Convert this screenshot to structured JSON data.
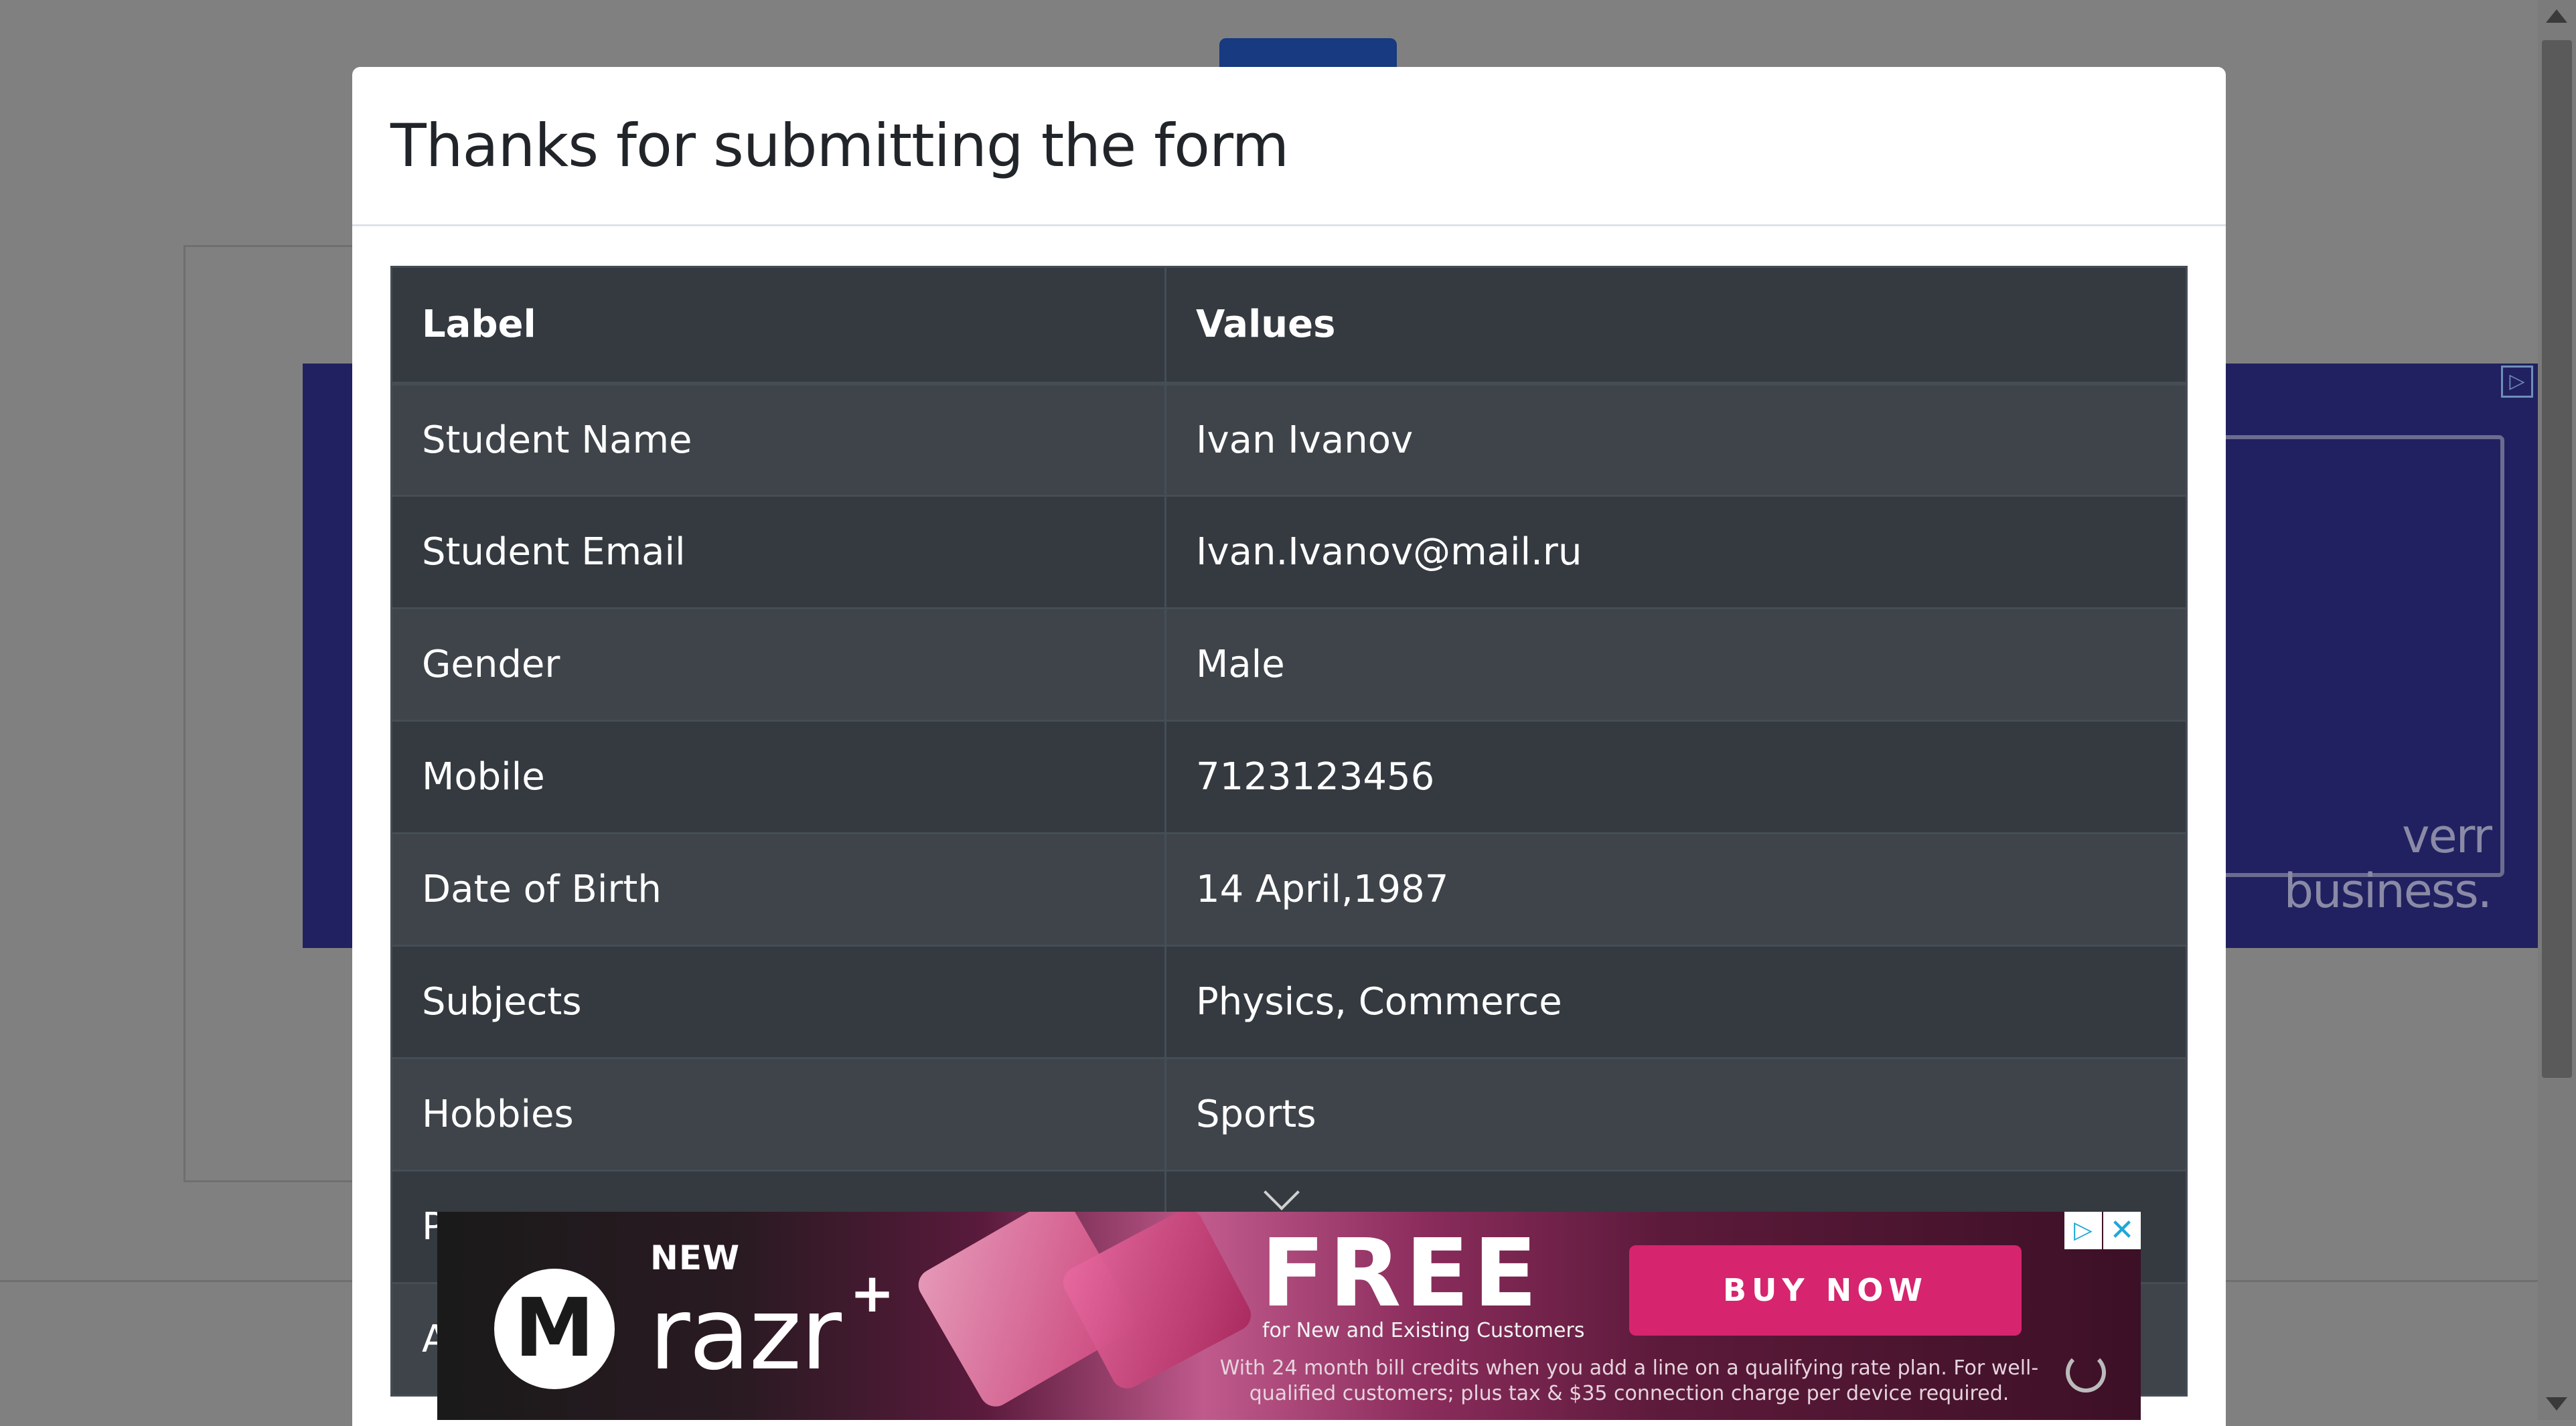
{
  "modal": {
    "title": "Thanks for submitting the form",
    "table": {
      "headers": [
        "Label",
        "Values"
      ],
      "rows": [
        {
          "label": "Student Name",
          "value": "Ivan Ivanov"
        },
        {
          "label": "Student Email",
          "value": "Ivan.Ivanov@mail.ru"
        },
        {
          "label": "Gender",
          "value": "Male"
        },
        {
          "label": "Mobile",
          "value": "7123123456"
        },
        {
          "label": "Date of Birth",
          "value": "14 April,1987"
        },
        {
          "label": "Subjects",
          "value": "Physics, Commerce"
        },
        {
          "label": "Hobbies",
          "value": "Sports"
        },
        {
          "label": "P",
          "value": ""
        },
        {
          "label": "A",
          "value": ""
        }
      ]
    }
  },
  "background_ad": {
    "brand_text": "verr business.",
    "choices_icon": "ad-choices-icon"
  },
  "bottom_ad": {
    "new_label": "NEW",
    "product": "razr",
    "product_plus": "+",
    "headline": "FREE",
    "subline": "for New and Existing Customers",
    "fine_print": "With 24 month bill credits when you add a line on a qualifying rate plan. For well-qualified customers; plus tax & $35 connection charge per device required.",
    "cta": "BUY NOW",
    "logo_icon": "motorola-logo-icon",
    "close_icon": "close-icon",
    "choices_icon": "ad-choices-icon",
    "refresh_icon": "refresh-icon"
  },
  "colors": {
    "overlay": "#808080",
    "table_dark": "#343a40",
    "table_dark_alt": "#3e444a",
    "ad_cta": "#d6246e",
    "ad_accent": "#1fa7d6"
  }
}
